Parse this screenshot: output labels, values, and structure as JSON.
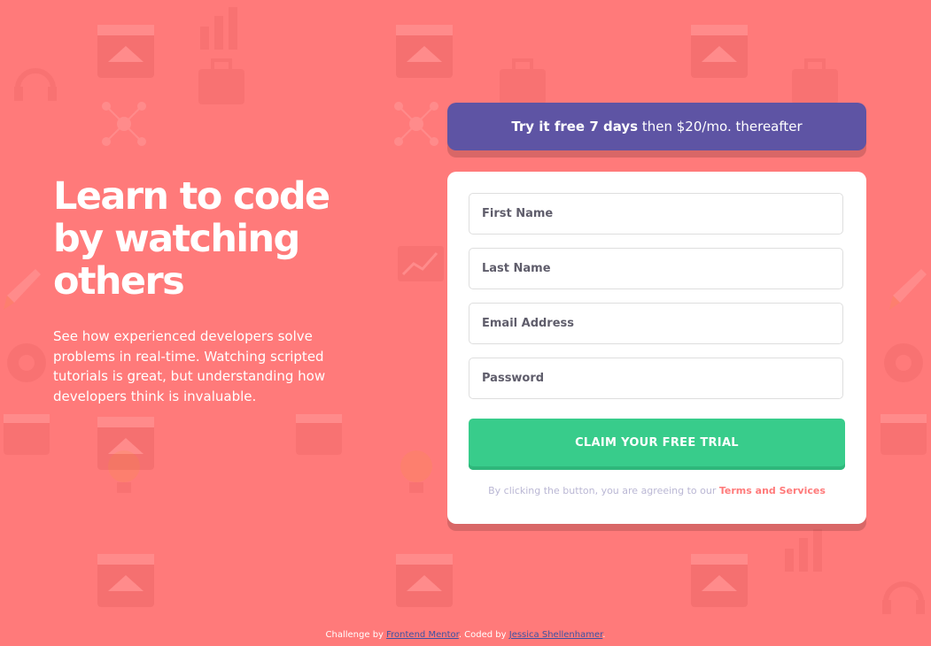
{
  "theme": {
    "background": "#ff7a7a",
    "banner": "#5e54a4",
    "accent_green": "#38cc8b",
    "accent_red": "#ff7a7a"
  },
  "hero": {
    "title_line1": "Learn to code",
    "title_line2": "by watching",
    "title_line3": "others",
    "text": "See how experienced developers solve problems in real-time. Watching scripted tutorials is great, but understanding how developers think is invaluable."
  },
  "banner": {
    "bold": "Try it free 7 days",
    "rest": " then $20/mo. thereafter"
  },
  "form": {
    "first_name_placeholder": "First Name",
    "last_name_placeholder": "Last Name",
    "email_placeholder": "Email Address",
    "password_placeholder": "Password",
    "submit_label": "CLAIM YOUR FREE TRIAL",
    "terms_prefix": "By clicking the button, you are agreeing to our ",
    "terms_link": "Terms and Services"
  },
  "footer": {
    "challenge_prefix": "Challenge by ",
    "challenge_link": "Frontend Mentor",
    "coded_prefix": ". Coded by ",
    "coded_link": "Jessica Shellenhamer",
    "suffix": "."
  }
}
